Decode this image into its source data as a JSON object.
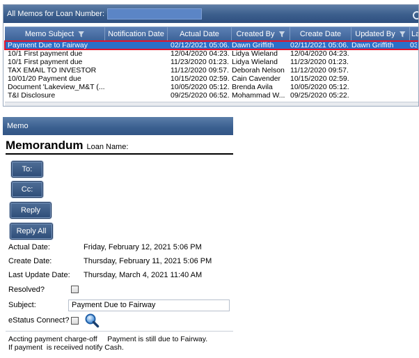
{
  "list": {
    "header_label": "All Memos for Loan Number:",
    "loan_number": "",
    "columns": [
      "Memo Subject",
      "Notification Date",
      "Actual Date",
      "Created By",
      "Create Date",
      "Updated By",
      "La"
    ],
    "rows": [
      {
        "subject": "Payment Due to Fairway",
        "notification": "",
        "actual": "02/12/2021 05:06...",
        "created_by": "Dawn Griffith",
        "create_date": "02/11/2021 05:06...",
        "updated_by": "Dawn Griffith",
        "last": "03"
      },
      {
        "subject": "10/1  First payment due",
        "notification": "",
        "actual": "12/04/2020 04:23...",
        "created_by": "Lidya Wieland",
        "create_date": "12/04/2020 04:23...",
        "updated_by": "",
        "last": ""
      },
      {
        "subject": "10/1  First payment due",
        "notification": "",
        "actual": "11/23/2020 01:23...",
        "created_by": "Lidya Wieland",
        "create_date": "11/23/2020 01:23...",
        "updated_by": "",
        "last": ""
      },
      {
        "subject": "TAX EMAIL TO INVESTOR",
        "notification": "",
        "actual": "11/12/2020 09:57...",
        "created_by": "Deborah Nelson",
        "create_date": "11/12/2020 09:57...",
        "updated_by": "",
        "last": ""
      },
      {
        "subject": "10/01/20 Payment due",
        "notification": "",
        "actual": "10/15/2020 02:59...",
        "created_by": "Cain Cavender",
        "create_date": "10/15/2020 02:59...",
        "updated_by": "",
        "last": ""
      },
      {
        "subject": "Document 'Lakeview_M&T (...",
        "notification": "",
        "actual": "10/05/2020 05:12...",
        "created_by": "Brenda Avila",
        "create_date": "10/05/2020 05:12...",
        "updated_by": "",
        "last": ""
      },
      {
        "subject": "T&I Disclosure",
        "notification": "",
        "actual": "09/25/2020 06:52...",
        "created_by": "Mohammad W...",
        "create_date": "09/25/2020 05:22...",
        "updated_by": "",
        "last": ""
      }
    ]
  },
  "memo": {
    "window_title": "Memo",
    "heading": "Memorandum",
    "loan_name_label": "Loan Name:",
    "to_label": "To:",
    "cc_label": "Cc:",
    "reply_label": "Reply",
    "reply_all_label": "Reply All",
    "actual_date_label": "Actual Date:",
    "actual_date": "Friday, February 12, 2021 5:06 PM",
    "create_date_label": "Create Date:",
    "create_date": "Thursday, February 11, 2021 5:06 PM",
    "last_update_label": "Last Update Date:",
    "last_update": "Thursday, March 4, 2021 11:40 AM",
    "resolved_label": "Resolved?",
    "subject_label": "Subject:",
    "subject_value": "Payment Due to Fairway",
    "estatus_label": "eStatus Connect?",
    "body_text": "Accting payment charge-off     Payment is still due to Fairway.\nIf payment  is receiived notify Cash."
  }
}
